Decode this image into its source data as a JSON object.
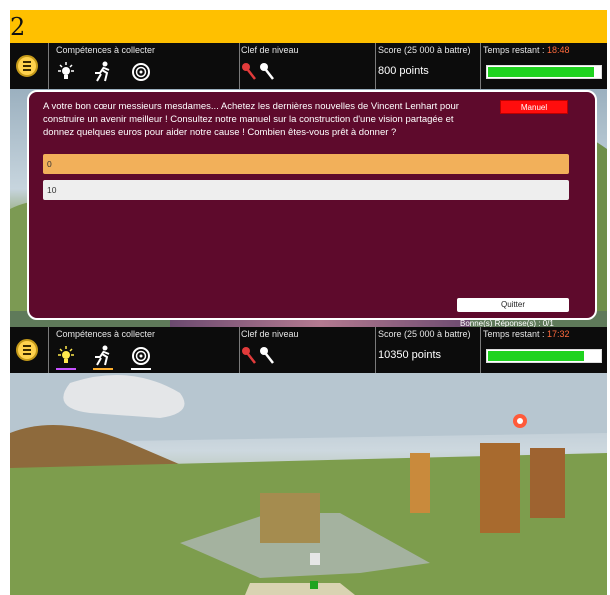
{
  "figure_label": "2",
  "hud": {
    "skills_caption": "Compétences à collecter",
    "key_caption": "Clef de niveau",
    "score_caption": "Score (25 000 à battre)",
    "time_caption": "Temps restant : ",
    "skills": [
      "lightbulb-icon",
      "runner-icon",
      "target-icon"
    ]
  },
  "top": {
    "time": "18:48",
    "score": "800 points",
    "time_fraction": 0.95,
    "question": "A votre bon cœur messieurs mesdames... Achetez les dernières nouvelles de Vincent Lenhart pour construire un avenir meilleur ! Consultez notre manuel sur la construction d'une vision partagée et donnez quelques euros pour aider notre cause ! Combien êtes-vous prêt à donner ?",
    "manual_label": "Manuel",
    "answers": [
      "0",
      "10"
    ],
    "quit_label": "Quitter",
    "bonnes_label": "Bonne(s) Réponse(s) : 0/1"
  },
  "bottom": {
    "time": "17:32",
    "score": "10350 points",
    "time_fraction": 0.86
  },
  "colors": {
    "accent": "#ffc000",
    "dialog": "#5e0a2c",
    "manual": "#ff0d0d",
    "timebar": "#1fd31f",
    "skill_bars": [
      "#c653ff",
      "#ffb02e",
      "#ffffff"
    ]
  }
}
